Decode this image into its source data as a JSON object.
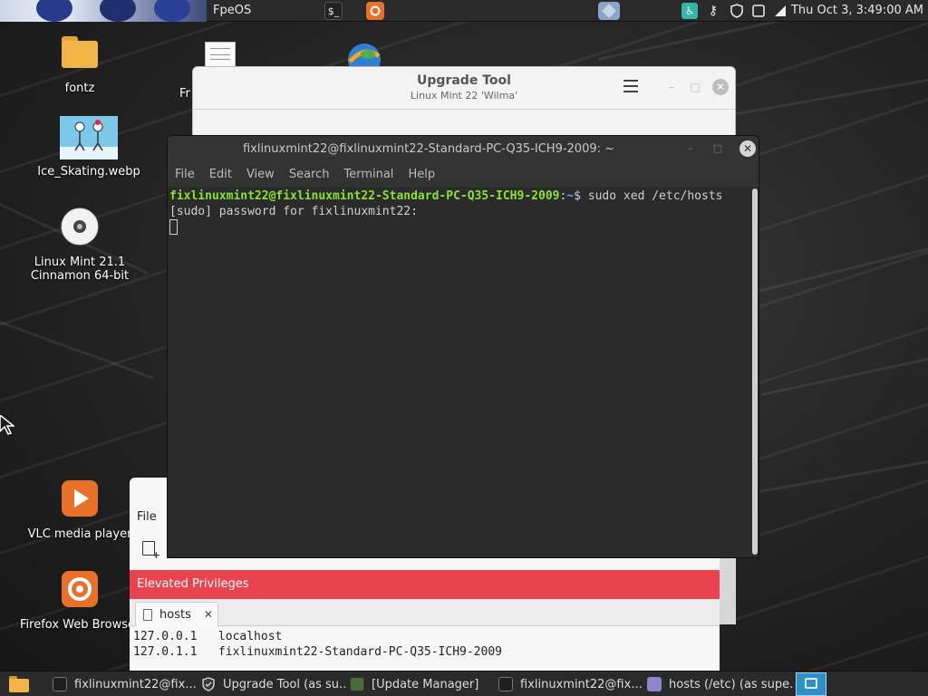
{
  "top_panel": {
    "window_title": "FpeOS",
    "clock": "Thu Oct  3,  3:49:00 AM"
  },
  "desktop": {
    "icons": [
      {
        "label": "fontz",
        "icon": "folder-icon"
      },
      {
        "label": "Ice_Skating.webp",
        "icon": "image-icon"
      },
      {
        "label": "Linux Mint 21.1 Cinnamon 64-bit",
        "line1": "Linux Mint 21.1",
        "line2": "Cinnamon 64-bit",
        "icon": "disc-icon"
      },
      {
        "label": "VLC media player",
        "icon": "vlc-icon"
      },
      {
        "label": "Firefox Web Browser",
        "icon": "firefox-icon"
      },
      {
        "label": "Fr",
        "icon": "document-icon"
      }
    ]
  },
  "upgrade_tool": {
    "title": "Upgrade Tool",
    "subtitle": "Linux Mint 22 'Wilma'"
  },
  "terminal": {
    "title": "fixlinuxmint22@fixlinuxmint22-Standard-PC-Q35-ICH9-2009: ~",
    "menu": [
      "File",
      "Edit",
      "View",
      "Search",
      "Terminal",
      "Help"
    ],
    "prompt_user": "fixlinuxmint22@fixlinuxmint22-Standard-PC-Q35-ICH9-2009",
    "prompt_sep": ":",
    "prompt_path": "~",
    "command": "$ sudo xed /etc/hosts",
    "output_line": "[sudo] password for fixlinuxmint22:"
  },
  "editor": {
    "menu_file": "File",
    "banner": "Elevated Privileges",
    "tab_label": "hosts",
    "lines": [
      "127.0.0.1   localhost",
      "127.0.1.1   fixlinuxmint22-Standard-PC-Q35-ICH9-2009"
    ]
  },
  "taskbar": {
    "items": [
      {
        "label": "fixlinuxmint22@fix...",
        "icon": "terminal-icon"
      },
      {
        "label": "Upgrade Tool (as su...",
        "icon": "shield-icon"
      },
      {
        "label": "[Update Manager]",
        "icon": "update-manager-icon"
      },
      {
        "label": "fixlinuxmint22@fix...",
        "icon": "terminal-icon"
      },
      {
        "label": "hosts (/etc) (as supe...",
        "icon": "text-editor-icon"
      }
    ]
  },
  "colors": {
    "banner_red": "#e8434e",
    "prompt_green": "#8ae234",
    "prompt_blue": "#729fcf"
  }
}
